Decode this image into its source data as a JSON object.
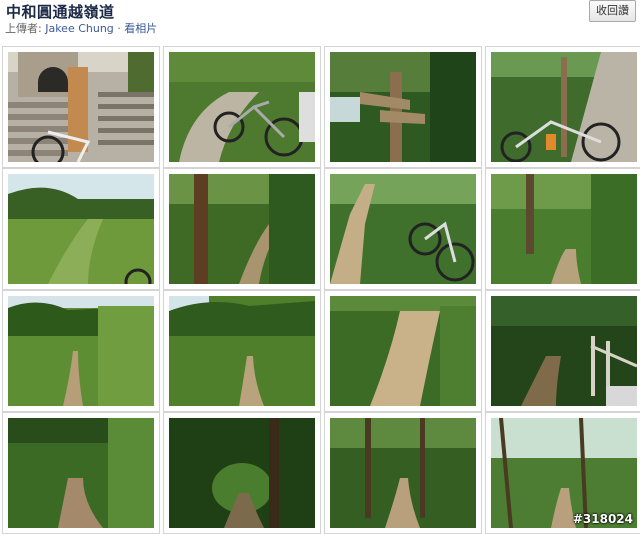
{
  "header": {
    "title": "中和圓通越嶺道",
    "uploader_label": "上傳者:",
    "uploader_name": "Jakee Chung",
    "separator": " · ",
    "view_photos": "看相片",
    "back_button": "收回讚"
  },
  "photos": [
    {
      "id": "photo-1",
      "scene": "stone-stairs-bike"
    },
    {
      "id": "photo-2",
      "scene": "path-bikes"
    },
    {
      "id": "photo-3",
      "scene": "signpost-forest"
    },
    {
      "id": "photo-4",
      "scene": "stairs-bike-railing"
    },
    {
      "id": "photo-5",
      "scene": "grass-trail-sky"
    },
    {
      "id": "photo-6",
      "scene": "forest-trail-trunk"
    },
    {
      "id": "photo-7",
      "scene": "dirt-trail-bike"
    },
    {
      "id": "photo-8",
      "scene": "forest-path"
    },
    {
      "id": "photo-9",
      "scene": "grassy-slope"
    },
    {
      "id": "photo-10",
      "scene": "grassy-hill-path"
    },
    {
      "id": "photo-11",
      "scene": "rocky-trail"
    },
    {
      "id": "photo-12",
      "scene": "dark-forest-fence"
    },
    {
      "id": "photo-13",
      "scene": "bamboo-trail"
    },
    {
      "id": "photo-14",
      "scene": "tunnel-forest"
    },
    {
      "id": "photo-15",
      "scene": "dense-forest-path"
    },
    {
      "id": "photo-16",
      "scene": "bright-forest-trees"
    }
  ],
  "watermark": "#318024",
  "colors": {
    "title": "#1c2a47",
    "link": "#3b5998",
    "meta": "#666666"
  }
}
